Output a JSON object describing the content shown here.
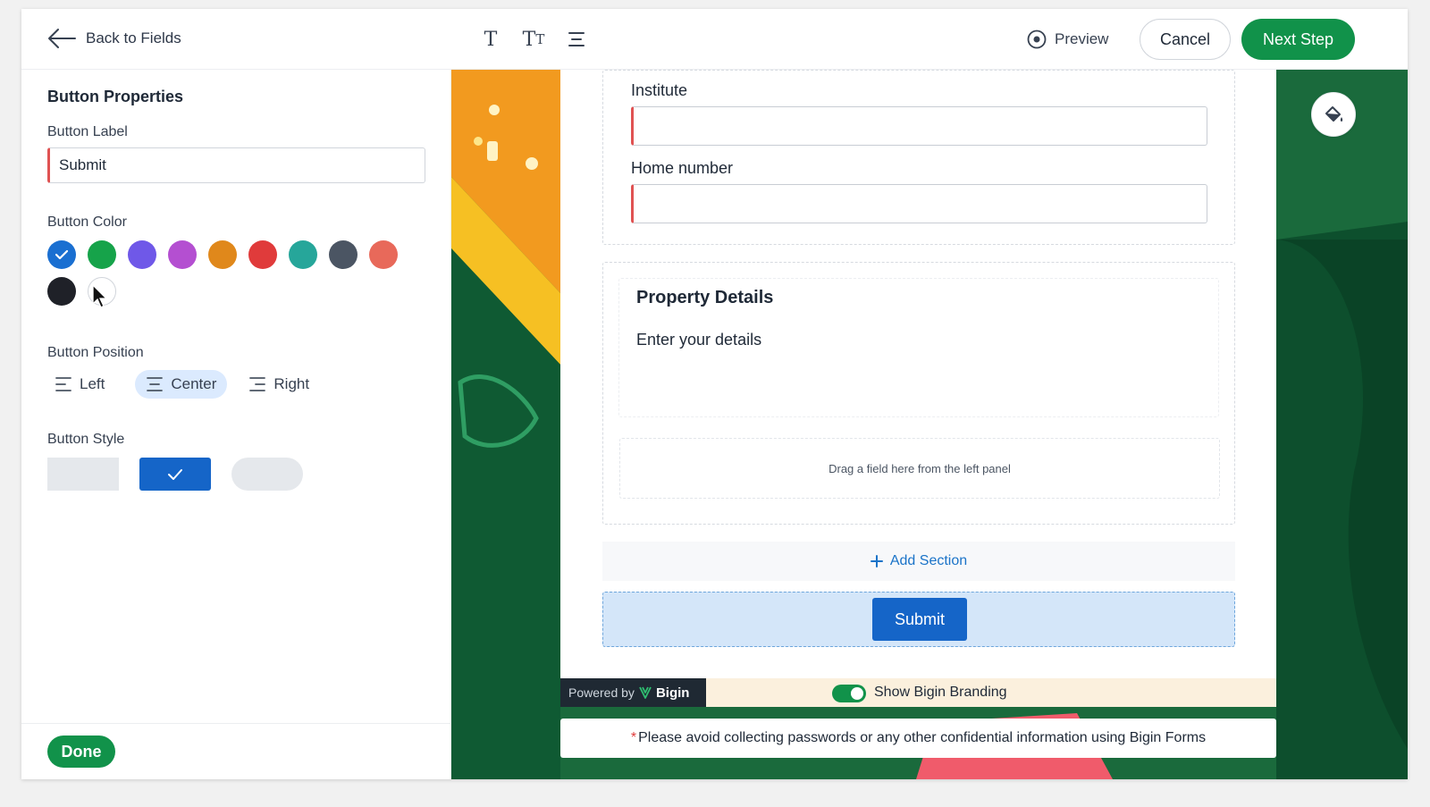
{
  "header": {
    "back_label": "Back to Fields",
    "preview_label": "Preview",
    "cancel_label": "Cancel",
    "next_label": "Next Step"
  },
  "panel": {
    "title": "Button Properties",
    "label_heading": "Button Label",
    "label_value": "Submit",
    "color_heading": "Button Color",
    "colors": [
      "#1a6fd1",
      "#16a34a",
      "#6f58e8",
      "#b44fd1",
      "#e0881b",
      "#e03b3b",
      "#26a69a",
      "#4b5563",
      "#e8695a",
      "#1f2128",
      "#ffffff"
    ],
    "selected_color_index": 0,
    "position_heading": "Button Position",
    "positions": [
      "Left",
      "Center",
      "Right"
    ],
    "selected_position": "Center",
    "style_heading": "Button Style",
    "selected_style_index": 1,
    "done_label": "Done"
  },
  "form": {
    "fields": [
      {
        "label": "Institute"
      },
      {
        "label": "Home number"
      }
    ],
    "section": {
      "title": "Property Details",
      "subtitle": "Enter your details",
      "drop_hint": "Drag a field here from the left panel"
    },
    "add_section_label": "Add Section",
    "submit_label": "Submit"
  },
  "branding": {
    "powered_by": "Powered by",
    "brand_name": "Bigin",
    "toggle_label": "Show Bigin Branding",
    "toggle_on": true
  },
  "warning": {
    "asterisk": "*",
    "text": "Please avoid collecting passwords or any other confidential information using Bigin Forms"
  },
  "colors": {
    "primary_green": "#11924a",
    "submit_blue": "#1565c8",
    "required_red": "#e05252"
  }
}
